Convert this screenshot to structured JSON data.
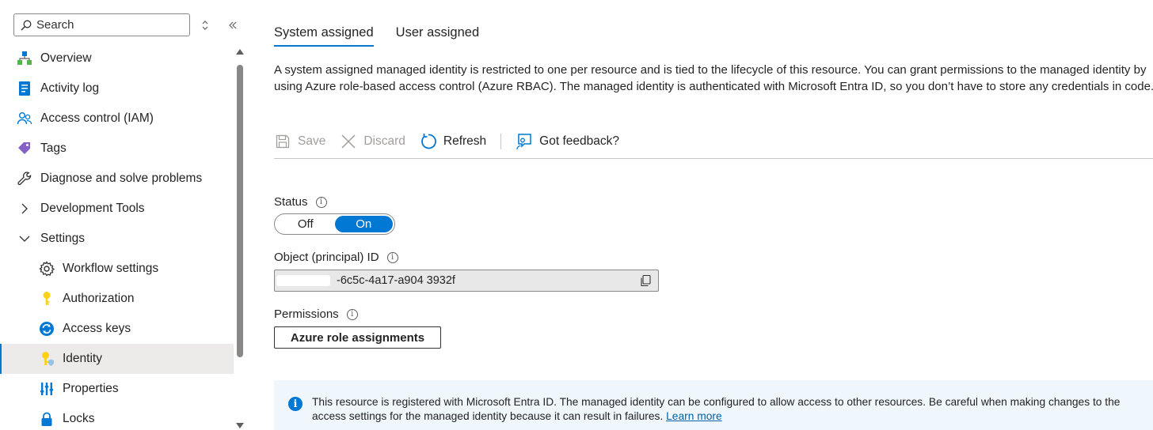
{
  "sidebar": {
    "search_placeholder": "Search",
    "items": [
      {
        "label": "Overview",
        "icon": "overview-icon"
      },
      {
        "label": "Activity log",
        "icon": "activity-log-icon"
      },
      {
        "label": "Access control (IAM)",
        "icon": "people-icon"
      },
      {
        "label": "Tags",
        "icon": "tag-icon"
      },
      {
        "label": "Diagnose and solve problems",
        "icon": "wrench-icon"
      },
      {
        "label": "Development Tools",
        "icon": "chevron-right-icon"
      },
      {
        "label": "Settings",
        "icon": "chevron-down-icon"
      },
      {
        "label": "Workflow settings",
        "icon": "gear-icon"
      },
      {
        "label": "Authorization",
        "icon": "key-icon"
      },
      {
        "label": "Access keys",
        "icon": "access-keys-icon"
      },
      {
        "label": "Identity",
        "icon": "identity-icon"
      },
      {
        "label": "Properties",
        "icon": "properties-icon"
      },
      {
        "label": "Locks",
        "icon": "lock-icon"
      }
    ]
  },
  "tabs": [
    {
      "label": "System assigned",
      "active": true
    },
    {
      "label": "User assigned",
      "active": false
    }
  ],
  "description": "A system assigned managed identity is restricted to one per resource and is tied to the lifecycle of this resource. You can grant permissions to the managed identity by using Azure role-based access control (Azure RBAC). The managed identity is authenticated with Microsoft Entra ID, so you don’t have to store any credentials in code.",
  "toolbar": {
    "save": "Save",
    "discard": "Discard",
    "refresh": "Refresh",
    "feedback": "Got feedback?"
  },
  "status": {
    "label": "Status",
    "off": "Off",
    "on": "On",
    "value": "On"
  },
  "object_id": {
    "label": "Object (principal) ID",
    "value": "-6c5c-4a17-a904  3932f"
  },
  "permissions": {
    "label": "Permissions",
    "button": "Azure role assignments"
  },
  "banner": {
    "text": "This resource is registered with Microsoft Entra ID. The managed identity can be configured to allow access to other resources. Be careful when making changes to the access settings for the managed identity because it can result in failures.",
    "link": "Learn more"
  },
  "colors": {
    "accent": "#0078d4",
    "banner_bg": "#eff6fc",
    "active_nav_bg": "#edebe9"
  }
}
